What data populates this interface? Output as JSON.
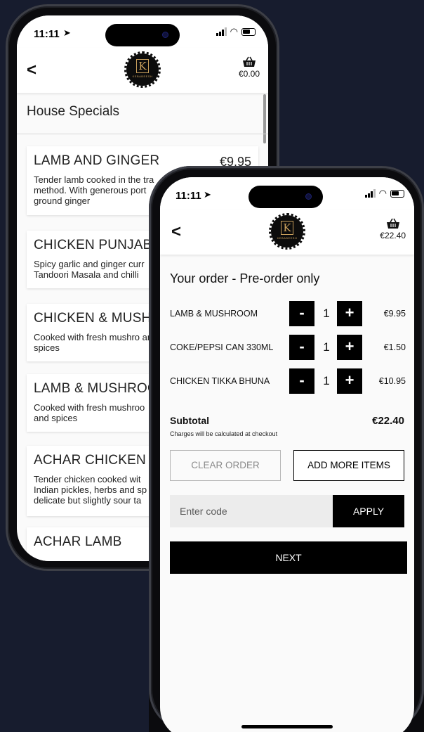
{
  "back_phone": {
    "status": {
      "time": "11:11"
    },
    "header": {
      "basket_total": "€0.00",
      "logo_brand": "KEBABEESH"
    },
    "section_title": "House Specials",
    "menu_items": [
      {
        "name": "LAMB AND GINGER",
        "price": "€9.95",
        "description": "Tender lamb cooked in the tra method. With generous port ground ginger"
      },
      {
        "name": "CHICKEN PUNJABI",
        "price": "",
        "description": "Spicy garlic and ginger curr Tandoori Masala and chilli"
      },
      {
        "name": "CHICKEN & MUSHR",
        "price": "",
        "description": "Cooked with fresh mushro and spices"
      },
      {
        "name": "LAMB & MUSHROO",
        "price": "",
        "description": "Cooked with fresh mushroo and spices"
      },
      {
        "name": "ACHAR CHICKEN",
        "price": "",
        "description": "Tender chicken cooked wit Indian pickles, herbs and sp delicate but slightly sour ta"
      },
      {
        "name": "ACHAR LAMB",
        "price": "",
        "description": ""
      }
    ]
  },
  "front_phone": {
    "status": {
      "time": "11:11"
    },
    "header": {
      "basket_total": "€22.40",
      "logo_brand": "KEBABEESH"
    },
    "order_title": "Your order - Pre-order only",
    "order_items": [
      {
        "name": "LAMB & MUSHROOM",
        "qty": "1",
        "price": "€9.95"
      },
      {
        "name": "COKE/PEPSI CAN 330ML",
        "qty": "1",
        "price": "€1.50"
      },
      {
        "name": "CHICKEN TIKKA BHUNA",
        "qty": "1",
        "price": "€10.95"
      }
    ],
    "qty_minus": "-",
    "qty_plus": "+",
    "subtotal_label": "Subtotal",
    "subtotal_value": "€22.40",
    "charges_note": "Charges will be calculated at checkout",
    "clear_label": "CLEAR ORDER",
    "add_label": "ADD MORE ITEMS",
    "code_placeholder": "Enter code",
    "apply_label": "APPLY",
    "next_label": "NEXT"
  },
  "colors": {
    "background": "#171c2e",
    "accent_gold": "#c9a05c",
    "button_black": "#000000"
  }
}
